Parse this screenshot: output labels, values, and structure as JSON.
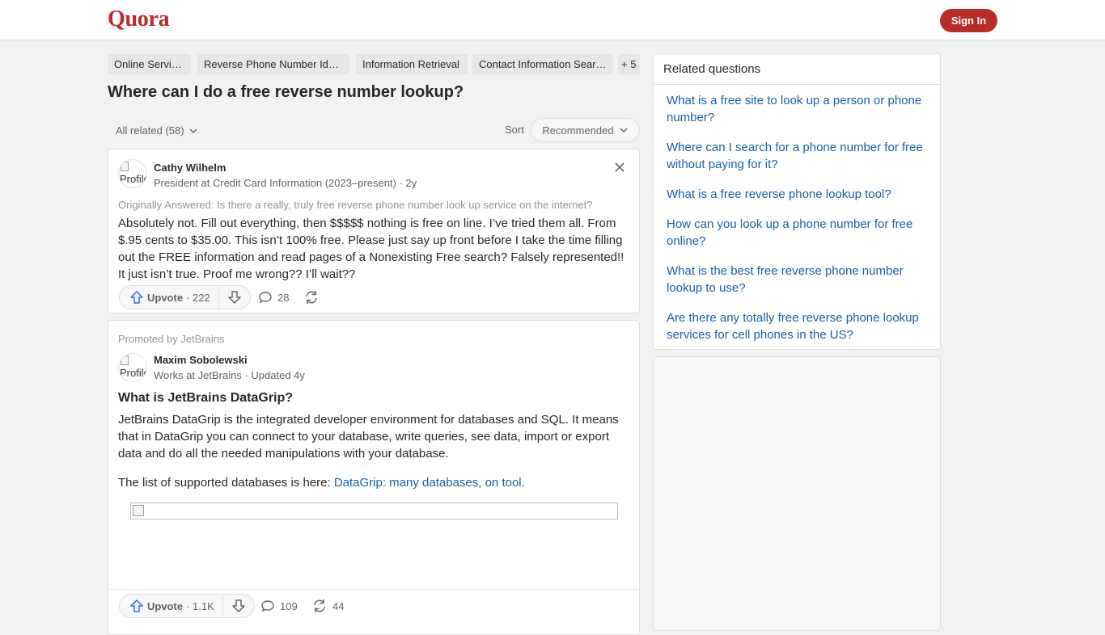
{
  "header": {
    "logo": "Quora",
    "signin_label": "Sign In"
  },
  "topics": {
    "items": [
      {
        "label": "Online Services"
      },
      {
        "label": "Reverse Phone Number Iden..."
      },
      {
        "label": "Information Retrieval"
      },
      {
        "label": "Contact Information Searc..."
      }
    ],
    "more_label": "+ 5"
  },
  "question": {
    "title": "Where can I do a free reverse number lookup?"
  },
  "filters": {
    "all_related": "All related (58)",
    "sort_label": "Sort",
    "sort_value": "Recommended"
  },
  "answer": {
    "avatar_alt": "Profile",
    "author_name": "Cathy Wilhelm",
    "author_credential": "President at Credit Card Information (2023–present) · 2y",
    "originally_answered": "Originally Answered: Is there a really, truly free reverse phone number look up service on the internet?",
    "text": "Absolutely not. Fill out everything, then $$$$$ nothing is free on line. I’ve tried them all. From $.95 cents to $35.00. This isn’t 100% free. Please just say up front before I take the time filling out the FREE information and read pages of a Nonexisting Free search? Falsely represented!! It just isn’t true. Proof me wrong?? I’ll wait??",
    "upvote_label": "Upvote",
    "upvote_count": "· 222",
    "comment_count": "28"
  },
  "promo": {
    "promoted_by": "Promoted by JetBrains",
    "avatar_alt": "Profile",
    "author_name": "Maxim Sobolewski",
    "author_credential": "Works at JetBrains · Updated 4y",
    "title": "What is JetBrains DataGrip?",
    "paragraph1": "JetBrains DataGrip is the integrated developer environment for databases and SQL. It means that in DataGrip you can connect to your database, write queries, see data, import or export data and do all the needed manipulations with your database.",
    "paragraph2_prefix": "The list of supported databases is here: ",
    "link_text": "DataGrip: many databases, on tool",
    "paragraph2_suffix": ".",
    "upvote_label": "Upvote",
    "upvote_count": "· 1.1K",
    "comment_count": "109",
    "share_count": "44"
  },
  "related": {
    "heading": "Related questions",
    "items": [
      {
        "text": "What is a free site to look up a person or phone number?"
      },
      {
        "text": "Where can I search for a phone number for free without paying for it?"
      },
      {
        "text": "What is a free reverse phone lookup tool?"
      },
      {
        "text": "How can you look up a phone number for free online?"
      },
      {
        "text": "What is the best free reverse phone number lookup to use?"
      },
      {
        "text": "Are there any totally free reverse phone lookup services for cell phones in the US?"
      }
    ]
  },
  "colors": {
    "brand": "#b92b27",
    "link": "#195faa",
    "upvote_icon": "#2e69ff"
  }
}
